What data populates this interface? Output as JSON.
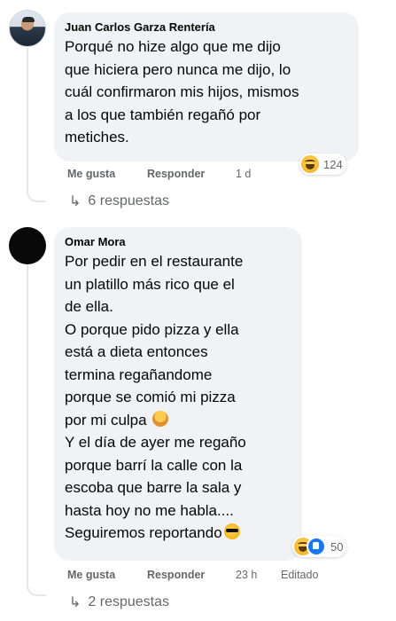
{
  "comments": [
    {
      "author": "Juan Carlos Garza Rentería",
      "lines": [
        "Porqué no hize algo que me dijo",
        "que hiciera pero nunca me dijo, lo",
        "cuál confirmaron mis hijos, mismos",
        "a los que también regañó por",
        "metiches."
      ],
      "like_label": "Me gusta",
      "reply_label": "Responder",
      "time": "1 d",
      "edited_label": "",
      "reaction_icons": [
        "haha-icon"
      ],
      "reaction_count": "124",
      "replies_label": "6 respuestas"
    },
    {
      "author": "Omar Mora",
      "lines": [
        "Por pedir en el restaurante",
        "un platillo más rico que el",
        "de ella.",
        "O porque pido pizza y ella",
        "está a dieta entonces",
        "termina regañandome",
        "porque se comió mi pizza",
        "por mi culpa",
        "Y el día de ayer me regaño",
        "porque barrí la calle con la",
        "escoba que barre la sala y",
        "hasta hoy no me habla....",
        "Seguiremos reportando"
      ],
      "like_label": "Me gusta",
      "reply_label": "Responder",
      "time": "23 h",
      "edited_label": "Editado",
      "reaction_icons": [
        "haha-icon",
        "like-icon"
      ],
      "reaction_count": "50",
      "replies_label": "2 respuestas"
    }
  ]
}
